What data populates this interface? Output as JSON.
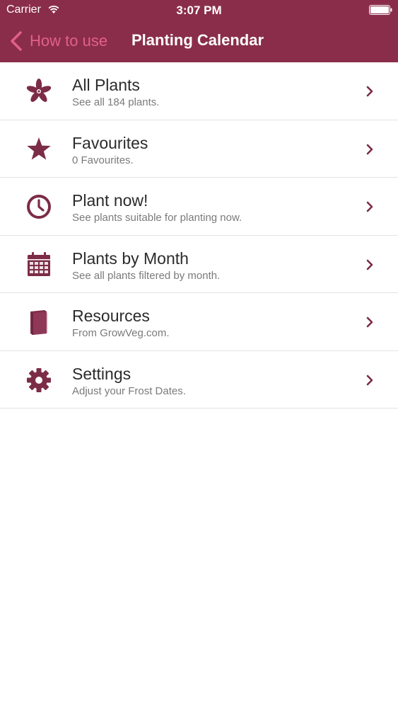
{
  "status_bar": {
    "carrier": "Carrier",
    "time": "3:07 PM"
  },
  "nav": {
    "back_label": "How to use",
    "title": "Planting Calendar"
  },
  "colors": {
    "brand": "#8a2d4b",
    "back_label": "#e2608a",
    "icon": "#7c2c47"
  },
  "menu": [
    {
      "icon": "flower-icon",
      "title": "All Plants",
      "subtitle": "See all 184 plants."
    },
    {
      "icon": "star-icon",
      "title": "Favourites",
      "subtitle": "0 Favourites."
    },
    {
      "icon": "clock-icon",
      "title": "Plant now!",
      "subtitle": "See plants suitable for planting now."
    },
    {
      "icon": "calendar-icon",
      "title": "Plants by Month",
      "subtitle": "See all plants filtered by month."
    },
    {
      "icon": "book-icon",
      "title": "Resources",
      "subtitle": "From GrowVeg.com."
    },
    {
      "icon": "gear-icon",
      "title": "Settings",
      "subtitle": "Adjust your Frost Dates."
    }
  ]
}
